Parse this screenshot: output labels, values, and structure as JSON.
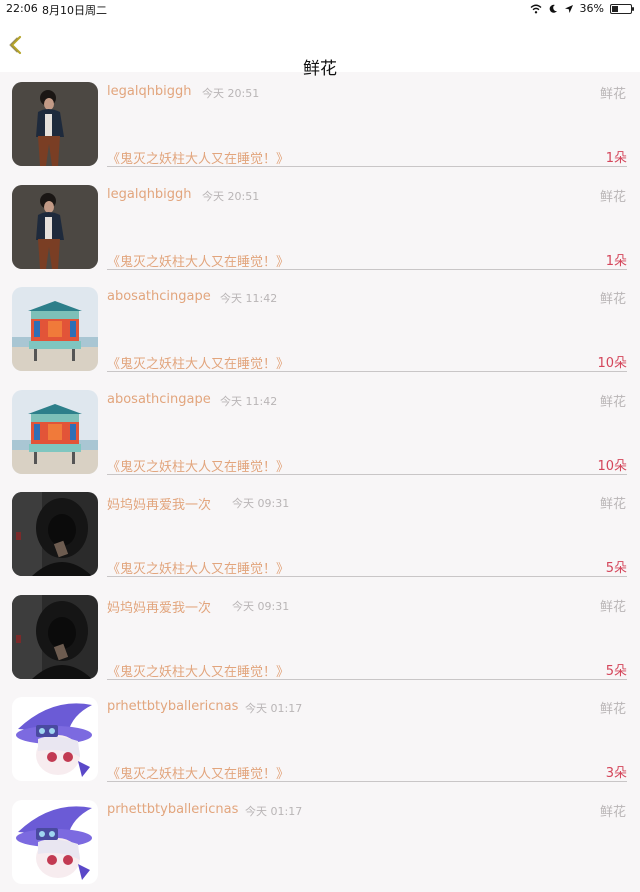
{
  "status_bar": {
    "time": "22:06",
    "date": "8月10日周二",
    "battery": "36%",
    "battery_level": 0.36
  },
  "nav": {
    "title": "鲜花",
    "back_icon": "chevron-left-icon",
    "accent": "#b5a42a"
  },
  "rows": [
    {
      "username": "legalqhbiggh",
      "time": "今天 20:51",
      "type": "鲜花",
      "book": "《鬼灭之妖柱大人又在睡觉！》",
      "count": "1朵",
      "avatar": "avatar-woman-photo"
    },
    {
      "username": "legalqhbiggh",
      "time": "今天 20:51",
      "type": "鲜花",
      "book": "《鬼灭之妖柱大人又在睡觉！》",
      "count": "1朵",
      "avatar": "avatar-woman-photo"
    },
    {
      "username": "abosathcingape",
      "time": "今天 11:42",
      "type": "鲜花",
      "book": "《鬼灭之妖柱大人又在睡觉！》",
      "count": "10朵",
      "avatar": "avatar-beach-hut"
    },
    {
      "username": "abosathcingape",
      "time": "今天 11:42",
      "type": "鲜花",
      "book": "《鬼灭之妖柱大人又在睡觉！》",
      "count": "10朵",
      "avatar": "avatar-beach-hut"
    },
    {
      "username": "妈坞妈再爱我一次",
      "time": "今天 09:31",
      "type": "鲜花",
      "book": "《鬼灭之妖柱大人又在睡觉！》",
      "count": "5朵",
      "avatar": "avatar-dark-hood"
    },
    {
      "username": "妈坞妈再爱我一次",
      "time": "今天 09:31",
      "type": "鲜花",
      "book": "《鬼灭之妖柱大人又在睡觉！》",
      "count": "5朵",
      "avatar": "avatar-dark-hood"
    },
    {
      "username": "prhettbtyballericnas",
      "time": "今天 01:17",
      "type": "鲜花",
      "book": "《鬼灭之妖柱大人又在睡觉！》",
      "count": "3朵",
      "avatar": "avatar-anime-witch"
    },
    {
      "username": "prhettbtyballericnas",
      "time": "今天 01:17",
      "type": "鲜花",
      "book": "",
      "count": "",
      "avatar": "avatar-anime-witch"
    }
  ],
  "colors": {
    "username": "#e2a57d",
    "time": "#b9b5b6",
    "count": "#d4455a",
    "background": "#f8f6f7"
  }
}
